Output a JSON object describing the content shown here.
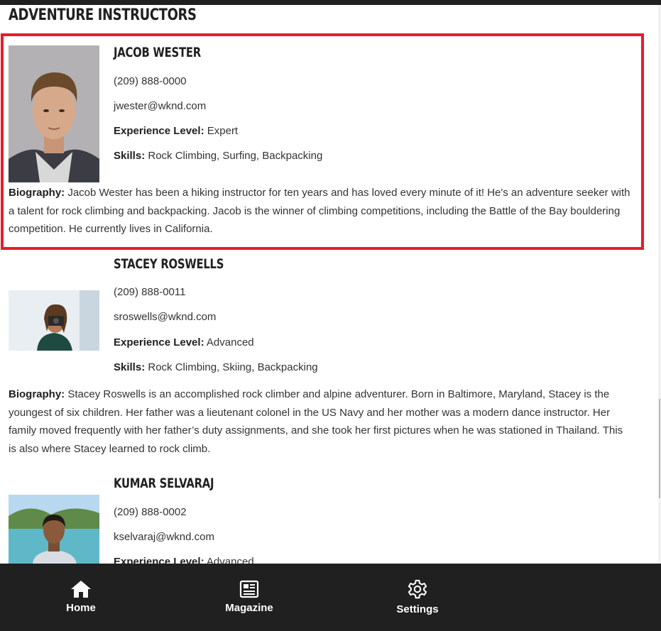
{
  "section_title": "ADVENTURE INSTRUCTORS",
  "labels": {
    "experience": "Experience Level:",
    "skills": "Skills:",
    "biography": "Biography:"
  },
  "instructors": [
    {
      "name": "JACOB WESTER",
      "phone": "(209) 888-0000",
      "email": "jwester@wknd.com",
      "experience": "Expert",
      "skills": "Rock Climbing, Surfing, Backpacking",
      "biography": "Jacob Wester has been a hiking instructor for ten years and has loved every minute of it! He's an adventure seeker with a talent for rock climbing and backpacking. Jacob is the winner of climbing competitions, including the Battle of the Bay bouldering competition. He currently lives in California."
    },
    {
      "name": "STACEY ROSWELLS",
      "phone": "(209) 888-0011",
      "email": "sroswells@wknd.com",
      "experience": "Advanced",
      "skills": "Rock Climbing, Skiing, Backpacking",
      "biography": "Stacey Roswells is an accomplished rock climber and alpine adventurer. Born in Baltimore, Maryland, Stacey is the youngest of six children. Her father was a lieutenant colonel in the US Navy and her mother was a modern dance instructor. Her family moved frequently with her father’s duty assignments, and she took her first pictures when he was stationed in Thailand. This is also where Stacey learned to rock climb."
    },
    {
      "name": "KUMAR SELVARAJ",
      "phone": "(209) 888-0002",
      "email": "kselvaraj@wknd.com",
      "experience": "Advanced"
    }
  ],
  "nav": [
    {
      "label": "Home",
      "icon": "home-icon"
    },
    {
      "label": "Magazine",
      "icon": "newspaper-icon"
    },
    {
      "label": "Settings",
      "icon": "gear-icon"
    }
  ],
  "colors": {
    "selection_border": "#e41d2c",
    "nav_background": "#202020",
    "text": "#202020"
  }
}
